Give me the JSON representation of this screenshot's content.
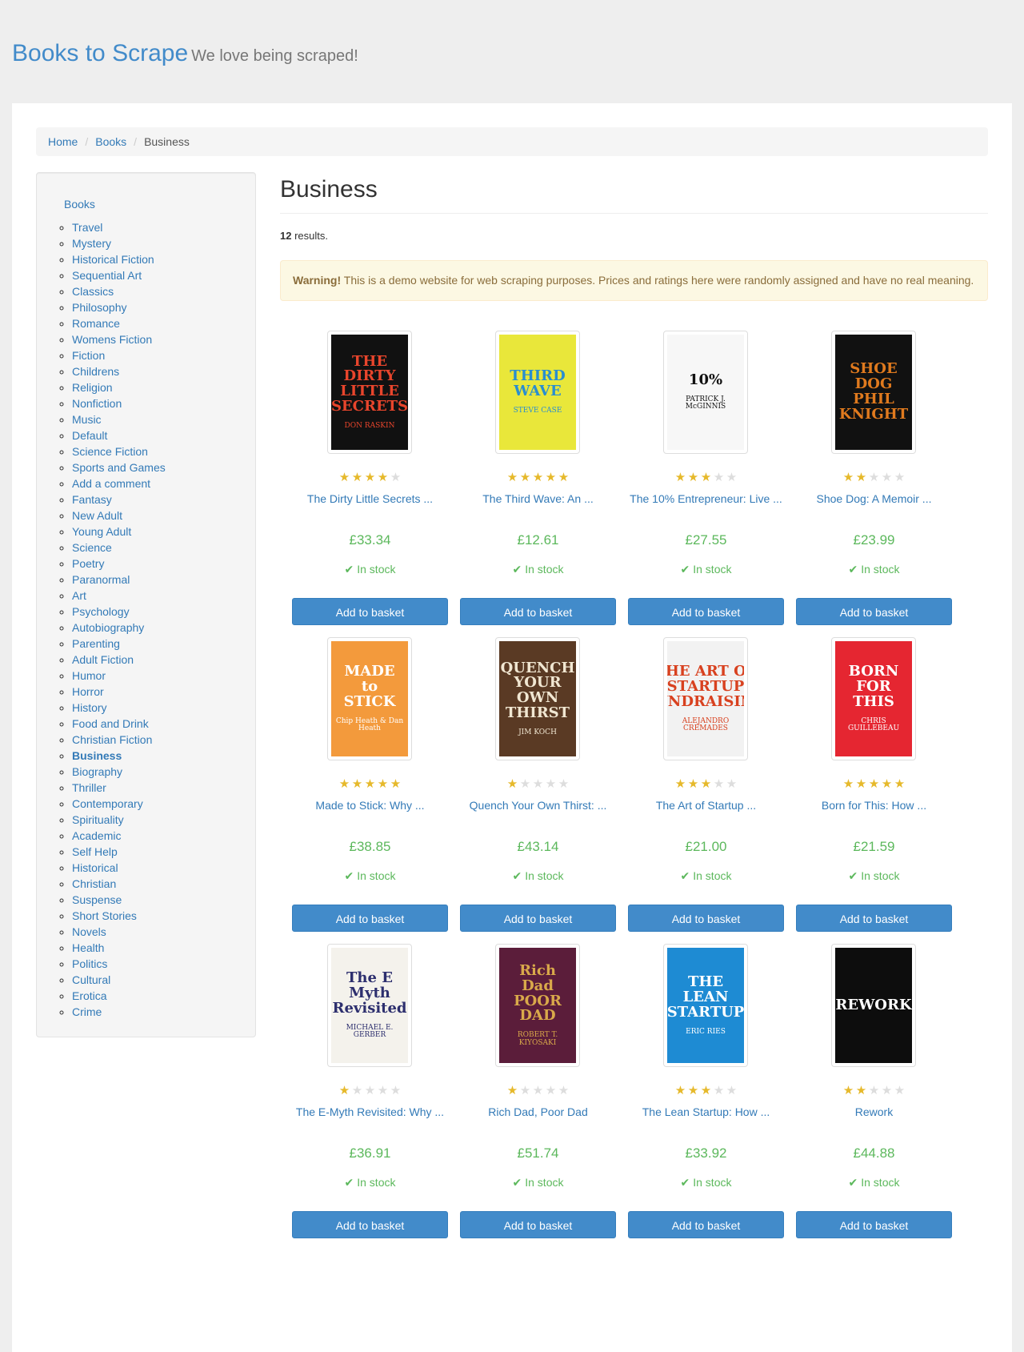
{
  "header": {
    "brand": "Books to Scrape",
    "tagline": "We love being scraped!"
  },
  "breadcrumb": {
    "home": "Home",
    "books": "Books",
    "current": "Business"
  },
  "sidebar": {
    "root": "Books",
    "categories": [
      "Travel",
      "Mystery",
      "Historical Fiction",
      "Sequential Art",
      "Classics",
      "Philosophy",
      "Romance",
      "Womens Fiction",
      "Fiction",
      "Childrens",
      "Religion",
      "Nonfiction",
      "Music",
      "Default",
      "Science Fiction",
      "Sports and Games",
      "Add a comment",
      "Fantasy",
      "New Adult",
      "Young Adult",
      "Science",
      "Poetry",
      "Paranormal",
      "Art",
      "Psychology",
      "Autobiography",
      "Parenting",
      "Adult Fiction",
      "Humor",
      "Horror",
      "History",
      "Food and Drink",
      "Christian Fiction",
      "Business",
      "Biography",
      "Thriller",
      "Contemporary",
      "Spirituality",
      "Academic",
      "Self Help",
      "Historical",
      "Christian",
      "Suspense",
      "Short Stories",
      "Novels",
      "Health",
      "Politics",
      "Cultural",
      "Erotica",
      "Crime"
    ],
    "current": "Business"
  },
  "main": {
    "title": "Business",
    "results_count": "12",
    "results_suffix": " results.",
    "warning_label": "Warning!",
    "warning_text": " This is a demo website for web scraping purposes. Prices and ratings here were randomly assigned and have no real meaning.",
    "stock_label": "In stock",
    "basket_label": "Add to basket"
  },
  "products": [
    {
      "title": "The Dirty Little Secrets ...",
      "price": "£33.34",
      "rating": 4,
      "cover_title": "THE DIRTY LITTLE SECRETS",
      "cover_author": "DON RASKIN",
      "cover_bg": "#111111",
      "cover_fg": "#e8452c"
    },
    {
      "title": "The Third Wave: An ...",
      "price": "£12.61",
      "rating": 5,
      "cover_title": "THIRD WAVE",
      "cover_author": "STEVE CASE",
      "cover_bg": "#e9e73a",
      "cover_fg": "#2a8ecf"
    },
    {
      "title": "The 10% Entrepreneur: Live ...",
      "price": "£27.55",
      "rating": 3,
      "cover_title": "10%",
      "cover_author": "PATRICK J. McGINNIS",
      "cover_bg": "#f7f7f7",
      "cover_fg": "#111111"
    },
    {
      "title": "Shoe Dog: A Memoir ...",
      "price": "£23.99",
      "rating": 2,
      "cover_title": "SHOE DOG PHIL KNIGHT",
      "cover_author": "",
      "cover_bg": "#111111",
      "cover_fg": "#e07a1e"
    },
    {
      "title": "Made to Stick: Why ...",
      "price": "£38.85",
      "rating": 5,
      "cover_title": "MADE to STICK",
      "cover_author": "Chip Heath & Dan Heath",
      "cover_bg": "#f39a3c",
      "cover_fg": "#ffffff"
    },
    {
      "title": "Quench Your Own Thirst: ...",
      "price": "£43.14",
      "rating": 1,
      "cover_title": "QUENCH YOUR OWN THIRST",
      "cover_author": "JIM KOCH",
      "cover_bg": "#5a3a24",
      "cover_fg": "#f1e7d2"
    },
    {
      "title": "The Art of Startup ...",
      "price": "£21.00",
      "rating": 3,
      "cover_title": "THE ART OF STARTUP FUNDRAISING",
      "cover_author": "ALEJANDRO CREMADES",
      "cover_bg": "#f2f2f2",
      "cover_fg": "#d8411f"
    },
    {
      "title": "Born for This: How ...",
      "price": "£21.59",
      "rating": 5,
      "cover_title": "BORN FOR THIS",
      "cover_author": "CHRIS GUILLEBEAU",
      "cover_bg": "#e52631",
      "cover_fg": "#ffffff"
    },
    {
      "title": "The E-Myth Revisited: Why ...",
      "price": "£36.91",
      "rating": 1,
      "cover_title": "The E Myth Revisited",
      "cover_author": "MICHAEL E. GERBER",
      "cover_bg": "#f4f2ec",
      "cover_fg": "#2d2f6e"
    },
    {
      "title": "Rich Dad, Poor Dad",
      "price": "£51.74",
      "rating": 1,
      "cover_title": "Rich Dad POOR DAD",
      "cover_author": "ROBERT T. KIYOSAKI",
      "cover_bg": "#5b1d3a",
      "cover_fg": "#d9a94a"
    },
    {
      "title": "The Lean Startup: How ...",
      "price": "£33.92",
      "rating": 3,
      "cover_title": "THE LEAN STARTUP",
      "cover_author": "ERIC RIES",
      "cover_bg": "#1e8bd3",
      "cover_fg": "#ffffff"
    },
    {
      "title": "Rework",
      "price": "£44.88",
      "rating": 2,
      "cover_title": "REWORK",
      "cover_author": "",
      "cover_bg": "#0d0d0d",
      "cover_fg": "#ffffff"
    }
  ],
  "colors": {
    "link": "#337ab7",
    "price": "#5cb85c",
    "star_on": "#e6b92b",
    "star_off": "#dddddd",
    "button": "#428bca"
  }
}
